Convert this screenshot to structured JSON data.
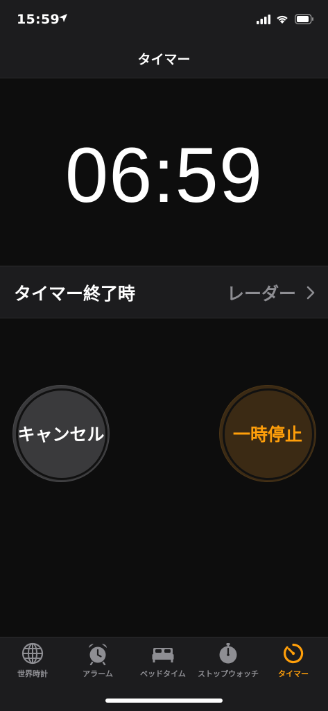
{
  "status_bar": {
    "time": "15:59",
    "icons": [
      "location-arrow-icon",
      "cellular-signal-icon",
      "wifi-icon",
      "battery-icon"
    ]
  },
  "nav": {
    "title": "タイマー"
  },
  "timer": {
    "remaining": "06:59"
  },
  "setting": {
    "label": "タイマー終了時",
    "value": "レーダー"
  },
  "buttons": {
    "cancel": "キャンセル",
    "pause": "一時停止"
  },
  "tabs": [
    {
      "label": "世界時計",
      "icon": "globe-icon",
      "active": false
    },
    {
      "label": "アラーム",
      "icon": "alarm-clock-icon",
      "active": false
    },
    {
      "label": "ベッドタイム",
      "icon": "bed-icon",
      "active": false
    },
    {
      "label": "ストップウォッチ",
      "icon": "stopwatch-icon",
      "active": false
    },
    {
      "label": "タイマー",
      "icon": "timer-icon",
      "active": true
    }
  ],
  "colors": {
    "accent": "#ff9f0a",
    "background": "#0d0d0d",
    "bar_background": "#1c1c1e",
    "inactive": "#8e8e93",
    "cancel_button": "#3a3a3c",
    "pause_button": "#3b2a14"
  }
}
